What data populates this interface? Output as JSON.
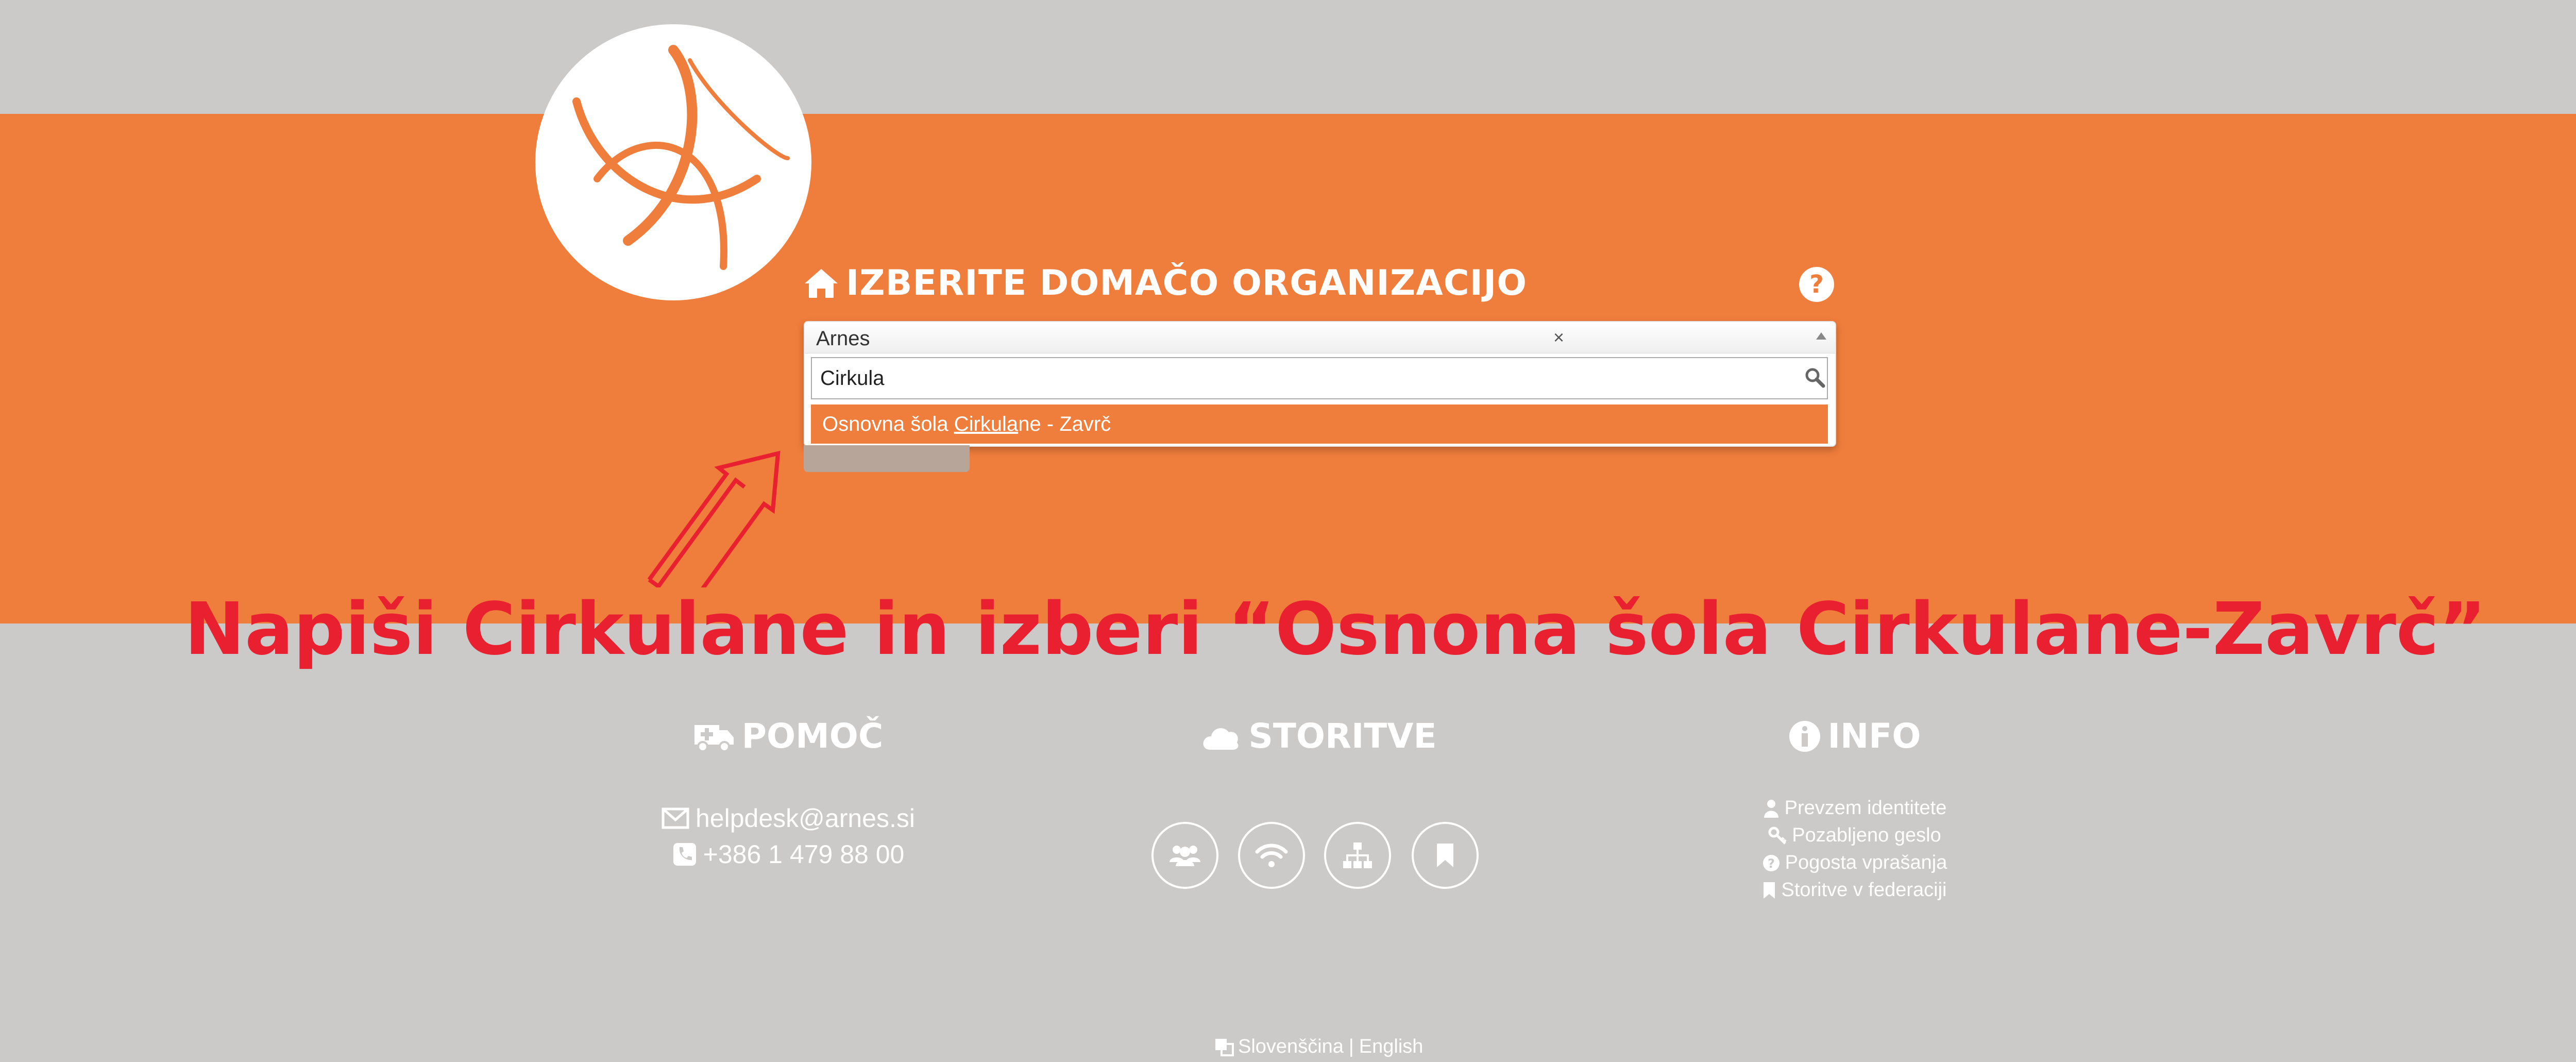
{
  "header": {
    "heading": "IZBERITE DOMAČO ORGANIZACIJO"
  },
  "select": {
    "selected_value": "Arnes",
    "clear_symbol": "×",
    "search_value": "Cirkula",
    "option": {
      "prefix": "Osnovna šola ",
      "match": "Cirkula",
      "suffix": "ne - Zavrč"
    }
  },
  "annotation": {
    "text": "Napiši Cirkulane in izberi “Osnona šola Cirkulane-Zavrč”",
    "color": "#e8202f"
  },
  "footer": {
    "help": {
      "title": "POMOČ",
      "email": "helpdesk@arnes.si",
      "phone": "+386 1 479 88 00"
    },
    "services": {
      "title": "STORITVE",
      "icons": [
        "users-icon",
        "wifi-icon",
        "sitemap-icon",
        "bookmark-icon"
      ]
    },
    "info": {
      "title": "INFO",
      "links": [
        "Prevzem identitete",
        "Pozabljeno geslo",
        "Pogosta vprašanja",
        "Storitve v federaciji"
      ]
    },
    "language": {
      "current": "Slovenščina",
      "separator": "|",
      "other": "English"
    }
  },
  "colors": {
    "accent": "#ef7d3c",
    "background": "#cbcac8",
    "annotation": "#e8202f"
  }
}
